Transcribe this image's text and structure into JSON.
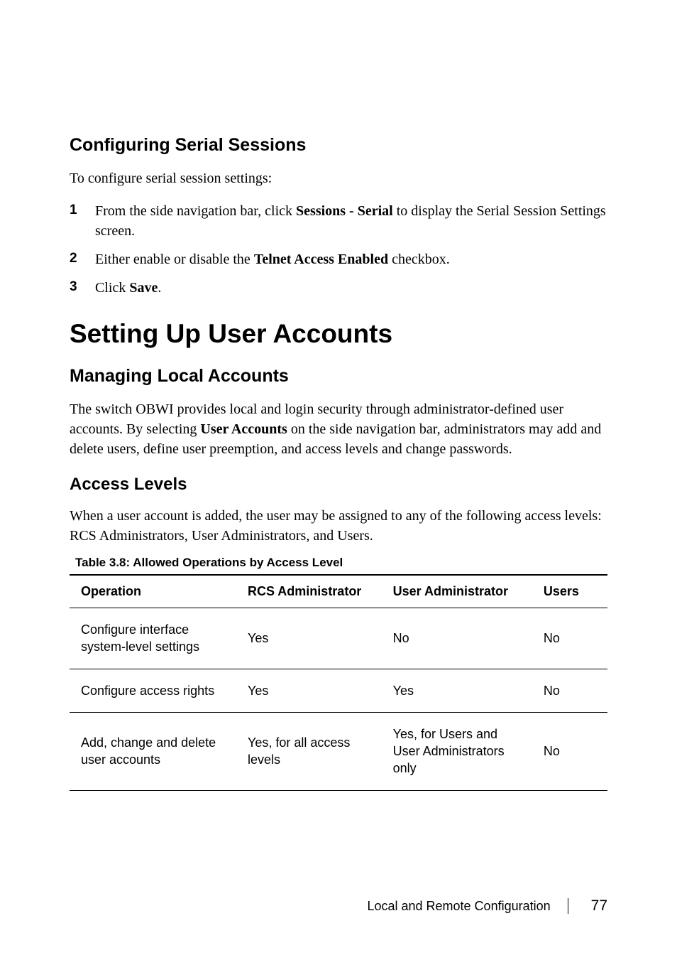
{
  "section1": {
    "heading": "Configuring Serial Sessions",
    "intro": "To configure serial session settings:",
    "steps": [
      {
        "num": "1",
        "pre": "From the side navigation bar, click ",
        "bold": "Sessions - Serial",
        "post": " to display the Serial Session Settings screen."
      },
      {
        "num": "2",
        "pre": "Either enable or disable the ",
        "bold": "Telnet Access Enabled",
        "post": " checkbox."
      },
      {
        "num": "3",
        "pre": "Click ",
        "bold": "Save",
        "post": "."
      }
    ]
  },
  "h1": "Setting Up User Accounts",
  "section2": {
    "heading": "Managing Local Accounts",
    "para_pre": "The switch OBWI provides local and login security through administrator-defined user accounts. By selecting ",
    "para_bold": "User Accounts",
    "para_post": " on the side navigation bar, administrators may add and delete users, define user preemption, and access levels and change passwords."
  },
  "section3": {
    "heading": "Access Levels",
    "para": "When a user account is added, the user may be assigned to any of the following access levels: RCS Administrators, User Administrators, and Users."
  },
  "table": {
    "caption": "Table 3.8: Allowed Operations by Access Level",
    "headers": [
      "Operation",
      "RCS Administrator",
      "User Administrator",
      "Users"
    ],
    "rows": [
      [
        "Configure interface system-level settings",
        "Yes",
        "No",
        "No"
      ],
      [
        "Configure access rights",
        "Yes",
        "Yes",
        "No"
      ],
      [
        "Add, change and delete user accounts",
        "Yes, for all access levels",
        "Yes, for Users and User Administrators only",
        "No"
      ]
    ]
  },
  "footer": {
    "text": "Local and Remote Configuration",
    "page": "77"
  }
}
